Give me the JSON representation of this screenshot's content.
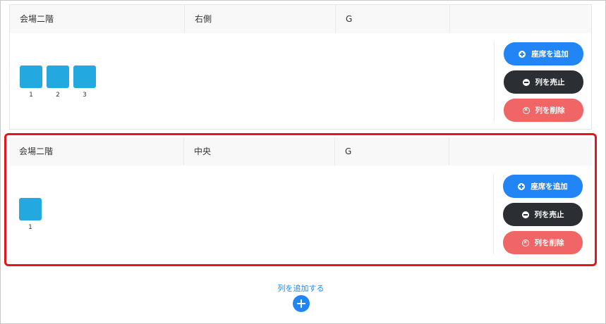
{
  "rows": [
    {
      "floor": "会場二階",
      "section": "右側",
      "row_name": "G",
      "seats": [
        "1",
        "2",
        "3"
      ],
      "buttons": {
        "add_seat": "座席を追加",
        "sell_row": "列を売止",
        "delete_row": "列を削除"
      }
    },
    {
      "floor": "会場二階",
      "section": "中央",
      "row_name": "G",
      "seats": [
        "1"
      ],
      "buttons": {
        "add_seat": "座席を追加",
        "sell_row": "列を売止",
        "delete_row": "列を削除"
      }
    }
  ],
  "add_row": {
    "label": "列を追加する"
  },
  "colors": {
    "seat": "#23a9e0",
    "primary": "#2185f5",
    "dark": "#2b2f33",
    "danger": "#f06565",
    "highlight": "#e3161b"
  }
}
